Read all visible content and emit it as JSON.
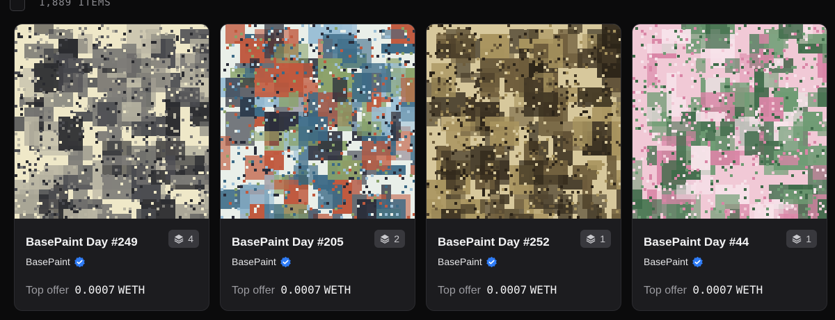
{
  "header": {
    "item_count": "1,889 ITEMS"
  },
  "cards": [
    {
      "title": "BasePaint Day #249",
      "editions": "4",
      "creator": "BasePaint",
      "offer_label": "Top offer",
      "offer_price": "0.0007",
      "offer_currency": "WETH",
      "palette": [
        "#efe8c8",
        "#2a2b2f",
        "#7d7c78",
        "#b9b5a3",
        "#4a4b50"
      ]
    },
    {
      "title": "BasePaint Day #205",
      "editions": "2",
      "creator": "BasePaint",
      "offer_label": "Top offer",
      "offer_price": "0.0007",
      "offer_currency": "WETH",
      "palette": [
        "#e9efe9",
        "#8aa36a",
        "#c05a3f",
        "#3c6a86",
        "#2a2d3a",
        "#9bbfd6"
      ]
    },
    {
      "title": "BasePaint Day #252",
      "editions": "1",
      "creator": "BasePaint",
      "offer_label": "Top offer",
      "offer_price": "0.0007",
      "offer_currency": "WETH",
      "palette": [
        "#d7c89c",
        "#2c2418",
        "#6e5d3c",
        "#a8945f",
        "#433826"
      ]
    },
    {
      "title": "BasePaint Day #44",
      "editions": "1",
      "creator": "BasePaint",
      "offer_label": "Top offer",
      "offer_price": "0.0007",
      "offer_currency": "WETH",
      "palette": [
        "#f1c9d6",
        "#6f9c74",
        "#d985a6",
        "#3f6b4a",
        "#f7e3ea"
      ]
    }
  ],
  "colors": {
    "background": "#0b0b0c",
    "card": "#1c1c1f",
    "badge": "#38383d",
    "verified": "#2f7cf6"
  },
  "icons": {
    "editions": "layers-icon",
    "verified": "verified-badge-icon"
  }
}
